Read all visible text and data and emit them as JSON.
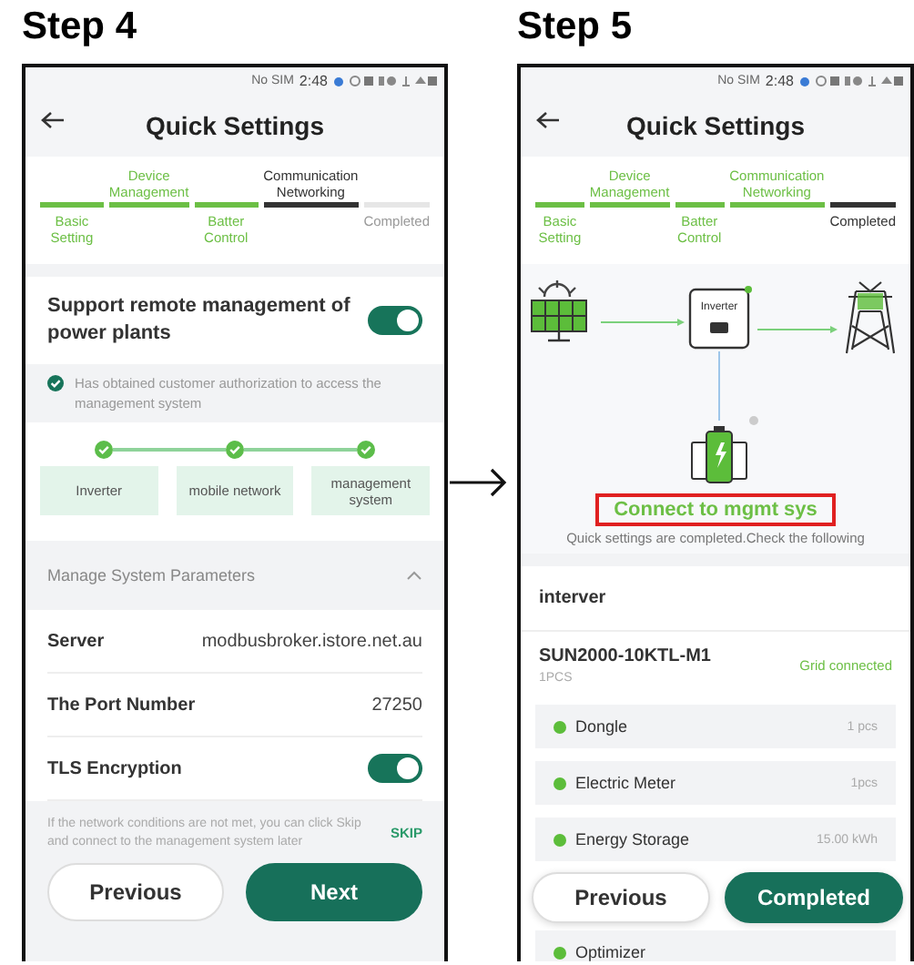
{
  "screens": [
    {
      "kind": "remote",
      "step_label": "Step 4",
      "status_bar": {
        "carrier": "No SIM",
        "time": "2:48"
      },
      "title": "Quick Settings",
      "steps": [
        {
          "label": "Basic Setting",
          "done": true,
          "selected": false
        },
        {
          "label": "Device Management",
          "done": true,
          "selected": false
        },
        {
          "label": "Batter Control",
          "done": true,
          "selected": false
        },
        {
          "label": "Communication Networking",
          "done": false,
          "selected": true
        },
        {
          "label": "Completed",
          "done": false,
          "selected": false
        }
      ],
      "remote_toggle": {
        "label": "Support remote management of power plants",
        "on": true
      },
      "authorization": {
        "text": "Has obtained customer authorization to access the management system",
        "checked": true
      },
      "chain": [
        {
          "label": "Inverter",
          "done": true
        },
        {
          "label": "mobile network",
          "done": true
        },
        {
          "label": "management system",
          "done": true
        }
      ],
      "section": {
        "title": "Manage System Parameters",
        "expanded": true
      },
      "params": [
        {
          "kind": "text",
          "label": "Server",
          "value": "modbusbroker.istore.net.au"
        },
        {
          "kind": "text",
          "label": "The Port Number",
          "value": "27250"
        },
        {
          "kind": "toggle",
          "label": "TLS Encryption",
          "on": true
        }
      ],
      "skip_note": "If the network conditions are not met, you can click Skip and connect to the management system later",
      "skip_link": "SKIP",
      "buttons": [
        {
          "label": "Previous",
          "primary": false
        },
        {
          "label": "Next",
          "primary": true
        }
      ]
    },
    {
      "kind": "summary",
      "step_label": "Step 5",
      "status_bar": {
        "carrier": "No SIM",
        "time": "2:48"
      },
      "title": "Quick Settings",
      "steps": [
        {
          "label": "Basic Setting",
          "done": true,
          "selected": false
        },
        {
          "label": "Device Management",
          "done": true,
          "selected": false
        },
        {
          "label": "Batter Control",
          "done": true,
          "selected": false
        },
        {
          "label": "Communication Networking",
          "done": true,
          "selected": false
        },
        {
          "label": "Completed",
          "done": false,
          "selected": true
        }
      ],
      "diagram": {
        "inverter_label": "Inverter"
      },
      "highlight": "Connect to mgmt sys",
      "completed_note": "Quick settings are completed.Check the following",
      "section_title": "interver",
      "device": {
        "model": "SUN2000-10KTL-M1",
        "count": "1PCS",
        "status": "Grid connected"
      },
      "components": [
        {
          "name": "Dongle",
          "value": "1 pcs"
        },
        {
          "name": "Electric Meter",
          "value": "1pcs"
        },
        {
          "name": "Energy Storage",
          "value": "15.00 kWh"
        },
        {
          "name": "Optimizer"
        }
      ],
      "buttons": [
        {
          "label": "Previous",
          "primary": false
        },
        {
          "label": "Completed",
          "primary": true
        }
      ]
    }
  ]
}
